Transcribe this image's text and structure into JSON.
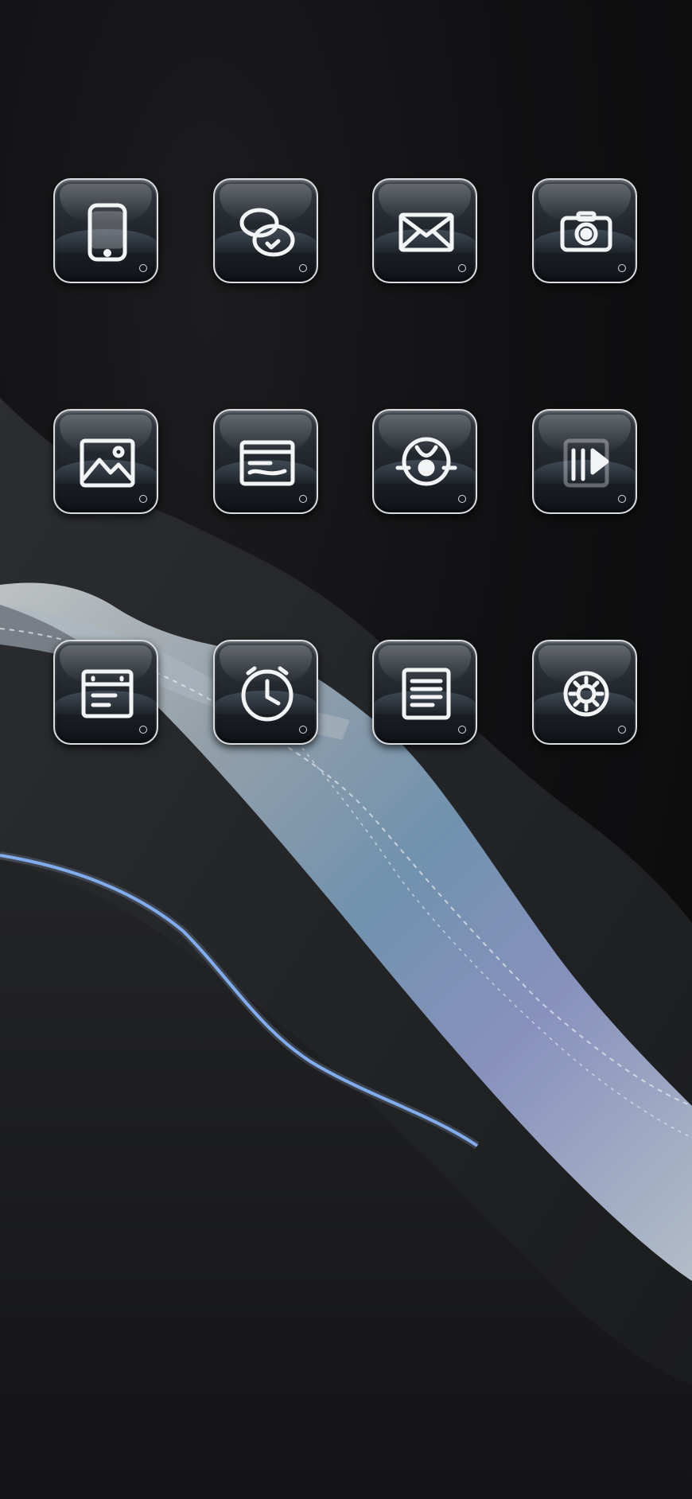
{
  "home_screen": {
    "icons": [
      {
        "id": "phone",
        "icon": "phone-icon"
      },
      {
        "id": "chat",
        "icon": "chat-bubbles-icon"
      },
      {
        "id": "mail",
        "icon": "envelope-icon"
      },
      {
        "id": "camera",
        "icon": "camera-icon"
      },
      {
        "id": "gallery",
        "icon": "image-icon"
      },
      {
        "id": "wallet",
        "icon": "wallet-icon"
      },
      {
        "id": "compass",
        "icon": "compass-icon"
      },
      {
        "id": "media",
        "icon": "media-play-icon"
      },
      {
        "id": "calendar",
        "icon": "calendar-icon"
      },
      {
        "id": "clock",
        "icon": "clock-icon"
      },
      {
        "id": "notes",
        "icon": "notes-icon"
      },
      {
        "id": "settings",
        "icon": "gear-icon"
      }
    ]
  },
  "colors": {
    "background": "#0b0b0c",
    "icon_border": "#d9dde2",
    "glyph": "#f2f4f6",
    "stripe_glow": "#7fb2ff"
  }
}
